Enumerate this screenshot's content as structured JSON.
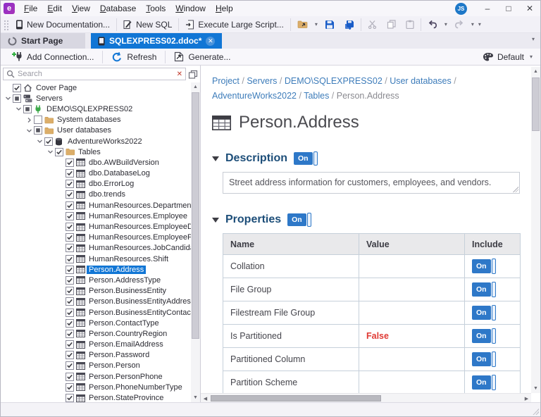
{
  "titlebar": {
    "menu": [
      "File",
      "Edit",
      "View",
      "Database",
      "Tools",
      "Window",
      "Help"
    ],
    "user_badge": "JS"
  },
  "toolbar": {
    "new_documentation": "New Documentation...",
    "new_sql": "New SQL",
    "execute_large_script": "Execute Large Script..."
  },
  "tabs": {
    "start_page": "Start Page",
    "document": "SQLEXPRESS02.ddoc*"
  },
  "actionbar": {
    "add_connection": "Add Connection...",
    "refresh": "Refresh",
    "generate": "Generate...",
    "theme": "Default"
  },
  "sidebar": {
    "search_placeholder": "Search",
    "tree": [
      {
        "label": "Cover Page",
        "lvl": 0,
        "exp": "none",
        "chk": "c",
        "icon": "home"
      },
      {
        "label": "Servers",
        "lvl": 0,
        "exp": "open",
        "chk": "p",
        "icon": "servers"
      },
      {
        "label": "DEMO\\SQLEXPRESS02",
        "lvl": 1,
        "exp": "open",
        "chk": "p",
        "icon": "plug"
      },
      {
        "label": "System databases",
        "lvl": 2,
        "exp": "closed",
        "chk": "u",
        "icon": "folder"
      },
      {
        "label": "User databases",
        "lvl": 2,
        "exp": "open",
        "chk": "p",
        "icon": "folder"
      },
      {
        "label": "AdventureWorks2022",
        "lvl": 3,
        "exp": "open",
        "chk": "c",
        "icon": "database"
      },
      {
        "label": "Tables",
        "lvl": 4,
        "exp": "open",
        "chk": "c",
        "icon": "folder"
      },
      {
        "label": "dbo.AWBuildVersion",
        "lvl": 5,
        "exp": "none",
        "chk": "c",
        "icon": "table"
      },
      {
        "label": "dbo.DatabaseLog",
        "lvl": 5,
        "exp": "none",
        "chk": "c",
        "icon": "table"
      },
      {
        "label": "dbo.ErrorLog",
        "lvl": 5,
        "exp": "none",
        "chk": "c",
        "icon": "table"
      },
      {
        "label": "dbo.trends",
        "lvl": 5,
        "exp": "none",
        "chk": "c",
        "icon": "table"
      },
      {
        "label": "HumanResources.Department",
        "lvl": 5,
        "exp": "none",
        "chk": "c",
        "icon": "table"
      },
      {
        "label": "HumanResources.Employee",
        "lvl": 5,
        "exp": "none",
        "chk": "c",
        "icon": "table"
      },
      {
        "label": "HumanResources.EmployeeDepartm...",
        "lvl": 5,
        "exp": "none",
        "chk": "c",
        "icon": "table"
      },
      {
        "label": "HumanResources.EmployeePayHistory",
        "lvl": 5,
        "exp": "none",
        "chk": "c",
        "icon": "table"
      },
      {
        "label": "HumanResources.JobCandidate",
        "lvl": 5,
        "exp": "none",
        "chk": "c",
        "icon": "table"
      },
      {
        "label": "HumanResources.Shift",
        "lvl": 5,
        "exp": "none",
        "chk": "c",
        "icon": "table"
      },
      {
        "label": "Person.Address",
        "lvl": 5,
        "exp": "none",
        "chk": "c",
        "icon": "table",
        "sel": true
      },
      {
        "label": "Person.AddressType",
        "lvl": 5,
        "exp": "none",
        "chk": "c",
        "icon": "table"
      },
      {
        "label": "Person.BusinessEntity",
        "lvl": 5,
        "exp": "none",
        "chk": "c",
        "icon": "table"
      },
      {
        "label": "Person.BusinessEntityAddress",
        "lvl": 5,
        "exp": "none",
        "chk": "c",
        "icon": "table"
      },
      {
        "label": "Person.BusinessEntityContact",
        "lvl": 5,
        "exp": "none",
        "chk": "c",
        "icon": "table"
      },
      {
        "label": "Person.ContactType",
        "lvl": 5,
        "exp": "none",
        "chk": "c",
        "icon": "table"
      },
      {
        "label": "Person.CountryRegion",
        "lvl": 5,
        "exp": "none",
        "chk": "c",
        "icon": "table"
      },
      {
        "label": "Person.EmailAddress",
        "lvl": 5,
        "exp": "none",
        "chk": "c",
        "icon": "table"
      },
      {
        "label": "Person.Password",
        "lvl": 5,
        "exp": "none",
        "chk": "c",
        "icon": "table"
      },
      {
        "label": "Person.Person",
        "lvl": 5,
        "exp": "none",
        "chk": "c",
        "icon": "table"
      },
      {
        "label": "Person.PersonPhone",
        "lvl": 5,
        "exp": "none",
        "chk": "c",
        "icon": "table"
      },
      {
        "label": "Person.PhoneNumberType",
        "lvl": 5,
        "exp": "none",
        "chk": "c",
        "icon": "table"
      },
      {
        "label": "Person.StateProvince",
        "lvl": 5,
        "exp": "none",
        "chk": "c",
        "icon": "table"
      }
    ]
  },
  "main": {
    "breadcrumb": [
      "Project",
      "Servers",
      "DEMO\\SQLEXPRESS02",
      "User databases",
      "AdventureWorks2022",
      "Tables",
      "Person.Address"
    ],
    "page_title": "Person.Address",
    "description": {
      "heading": "Description",
      "toggle_state": "On",
      "text": "Street address information for customers, employees, and vendors."
    },
    "properties": {
      "heading": "Properties",
      "toggle_state": "On",
      "columns": [
        "Name",
        "Value",
        "Include"
      ],
      "rows": [
        {
          "name": "Collation",
          "value": "",
          "include": "On"
        },
        {
          "name": "File Group",
          "value": "",
          "include": "On"
        },
        {
          "name": "Filestream File Group",
          "value": "",
          "include": "On"
        },
        {
          "name": "Is Partitioned",
          "value": "False",
          "value_is_false": true,
          "include": "On"
        },
        {
          "name": "Partitioned Column",
          "value": "",
          "include": "On"
        },
        {
          "name": "Partition Scheme",
          "value": "",
          "include": "On"
        }
      ]
    }
  },
  "icons": {
    "app-logo": "e",
    "search-icon": "magnifier",
    "clear-search-icon": "x",
    "collapse-all-icon": "stacked-squares",
    "start-page-icon": "circle",
    "document-icon": "tablet",
    "save-icon": "floppy",
    "save-all-icon": "floppy-arrow",
    "cut-icon": "scissors",
    "copy-icon": "pages",
    "paste-icon": "clipboard",
    "undo-icon": "curved-arrow-left",
    "redo-icon": "curved-arrow-right",
    "open-icon": "folder-arrow",
    "add-connection-icon": "plug-plus",
    "refresh-icon": "circular-arrow",
    "generate-icon": "page-arrow",
    "theme-icon": "palette",
    "table-icon": "grid",
    "modules-icon": "four-squares"
  },
  "colors": {
    "accent_blue": "#1176d5",
    "toggle_blue": "#2e78c8",
    "link_blue": "#3d7cba",
    "heading_navy": "#1d4e79",
    "false_red": "#e03a34",
    "folder_tan": "#d9a95f",
    "plug_green": "#3da94a",
    "save_blue": "#1a5dc8"
  }
}
